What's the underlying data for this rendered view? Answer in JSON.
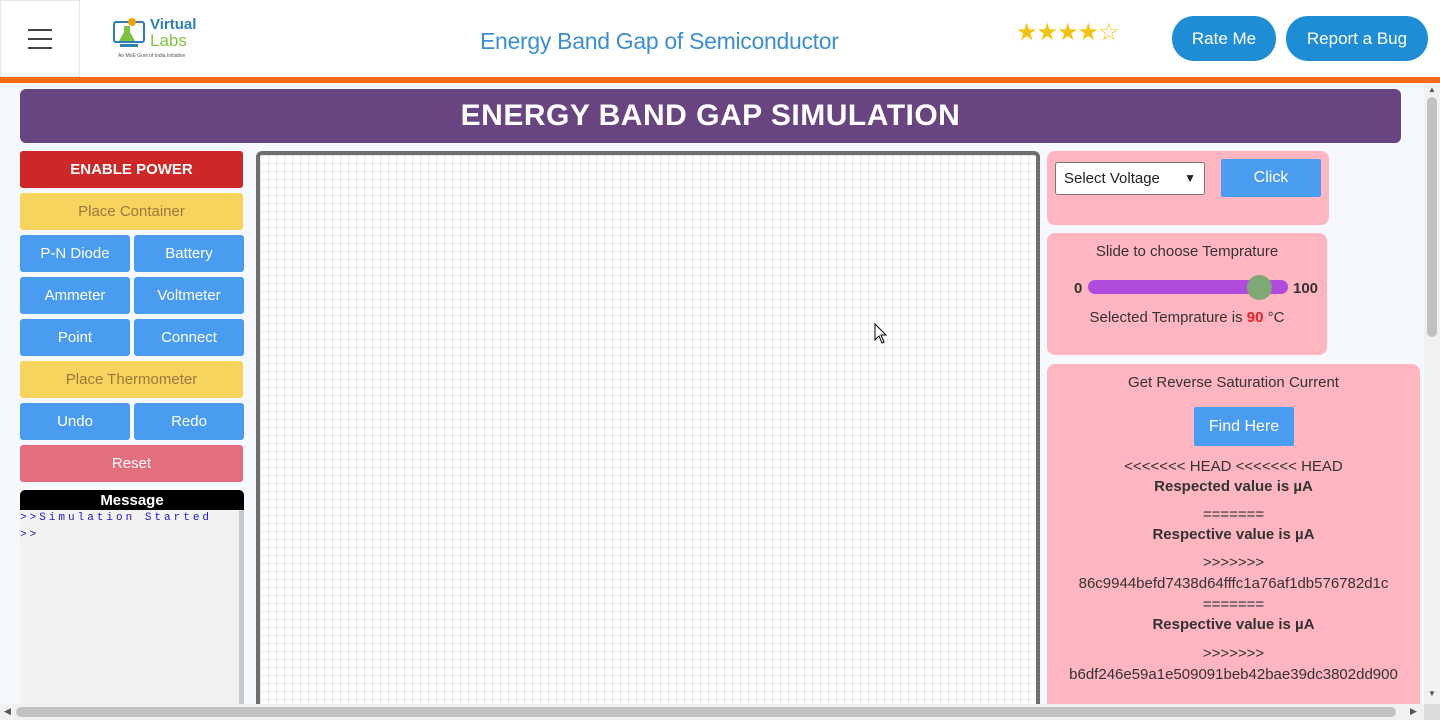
{
  "header": {
    "logo_line1": "Virtual",
    "logo_line2": "Labs",
    "logo_sub": "An MoE Govt of India Initiative",
    "title": "Energy Band Gap of Semiconductor",
    "rating_stars_filled": 4,
    "rating_stars_total": 5,
    "rate_label": "Rate Me",
    "bug_label": "Report a Bug"
  },
  "banner": {
    "title": "ENERGY BAND GAP SIMULATION"
  },
  "controls": {
    "enable_power": "ENABLE POWER",
    "place_container": "Place Container",
    "pn_diode": "P-N Diode",
    "battery": "Battery",
    "ammeter": "Ammeter",
    "voltmeter": "Voltmeter",
    "point": "Point",
    "connect": "Connect",
    "place_thermometer": "Place Thermometer",
    "undo": "Undo",
    "redo": "Redo",
    "reset": "Reset"
  },
  "message": {
    "title": "Message",
    "lines": [
      ">>Simulation Started",
      ">>"
    ]
  },
  "voltage": {
    "select_value": "Select Voltage",
    "click_label": "Click"
  },
  "temperature": {
    "title": "Slide to choose Temprature",
    "min": "0",
    "max": "100",
    "value": 90,
    "prefix": "Selected Temprature is",
    "value_text": "90",
    "unit": "°C"
  },
  "saturation": {
    "title": "Get Reverse Saturation Current",
    "find_label": "Find Here",
    "lines": [
      "<<<<<<< HEAD <<<<<<< HEAD",
      "Respected value is  µA",
      "=======",
      "Respective value is  µA",
      ">>>>>>>",
      "86c9944befd7438d64fffc1a76af1db576782d1c",
      "=======",
      "Respective value is  µA",
      ">>>>>>>",
      "b6df246e59a1e509091beb42bae39dc3802dd900"
    ]
  },
  "colors": {
    "banner": "#684581",
    "accent_orange": "#f56a17",
    "button_blue": "#4a9cf0",
    "panel_pink": "#ffb6c1",
    "power_red": "#ce2727"
  }
}
